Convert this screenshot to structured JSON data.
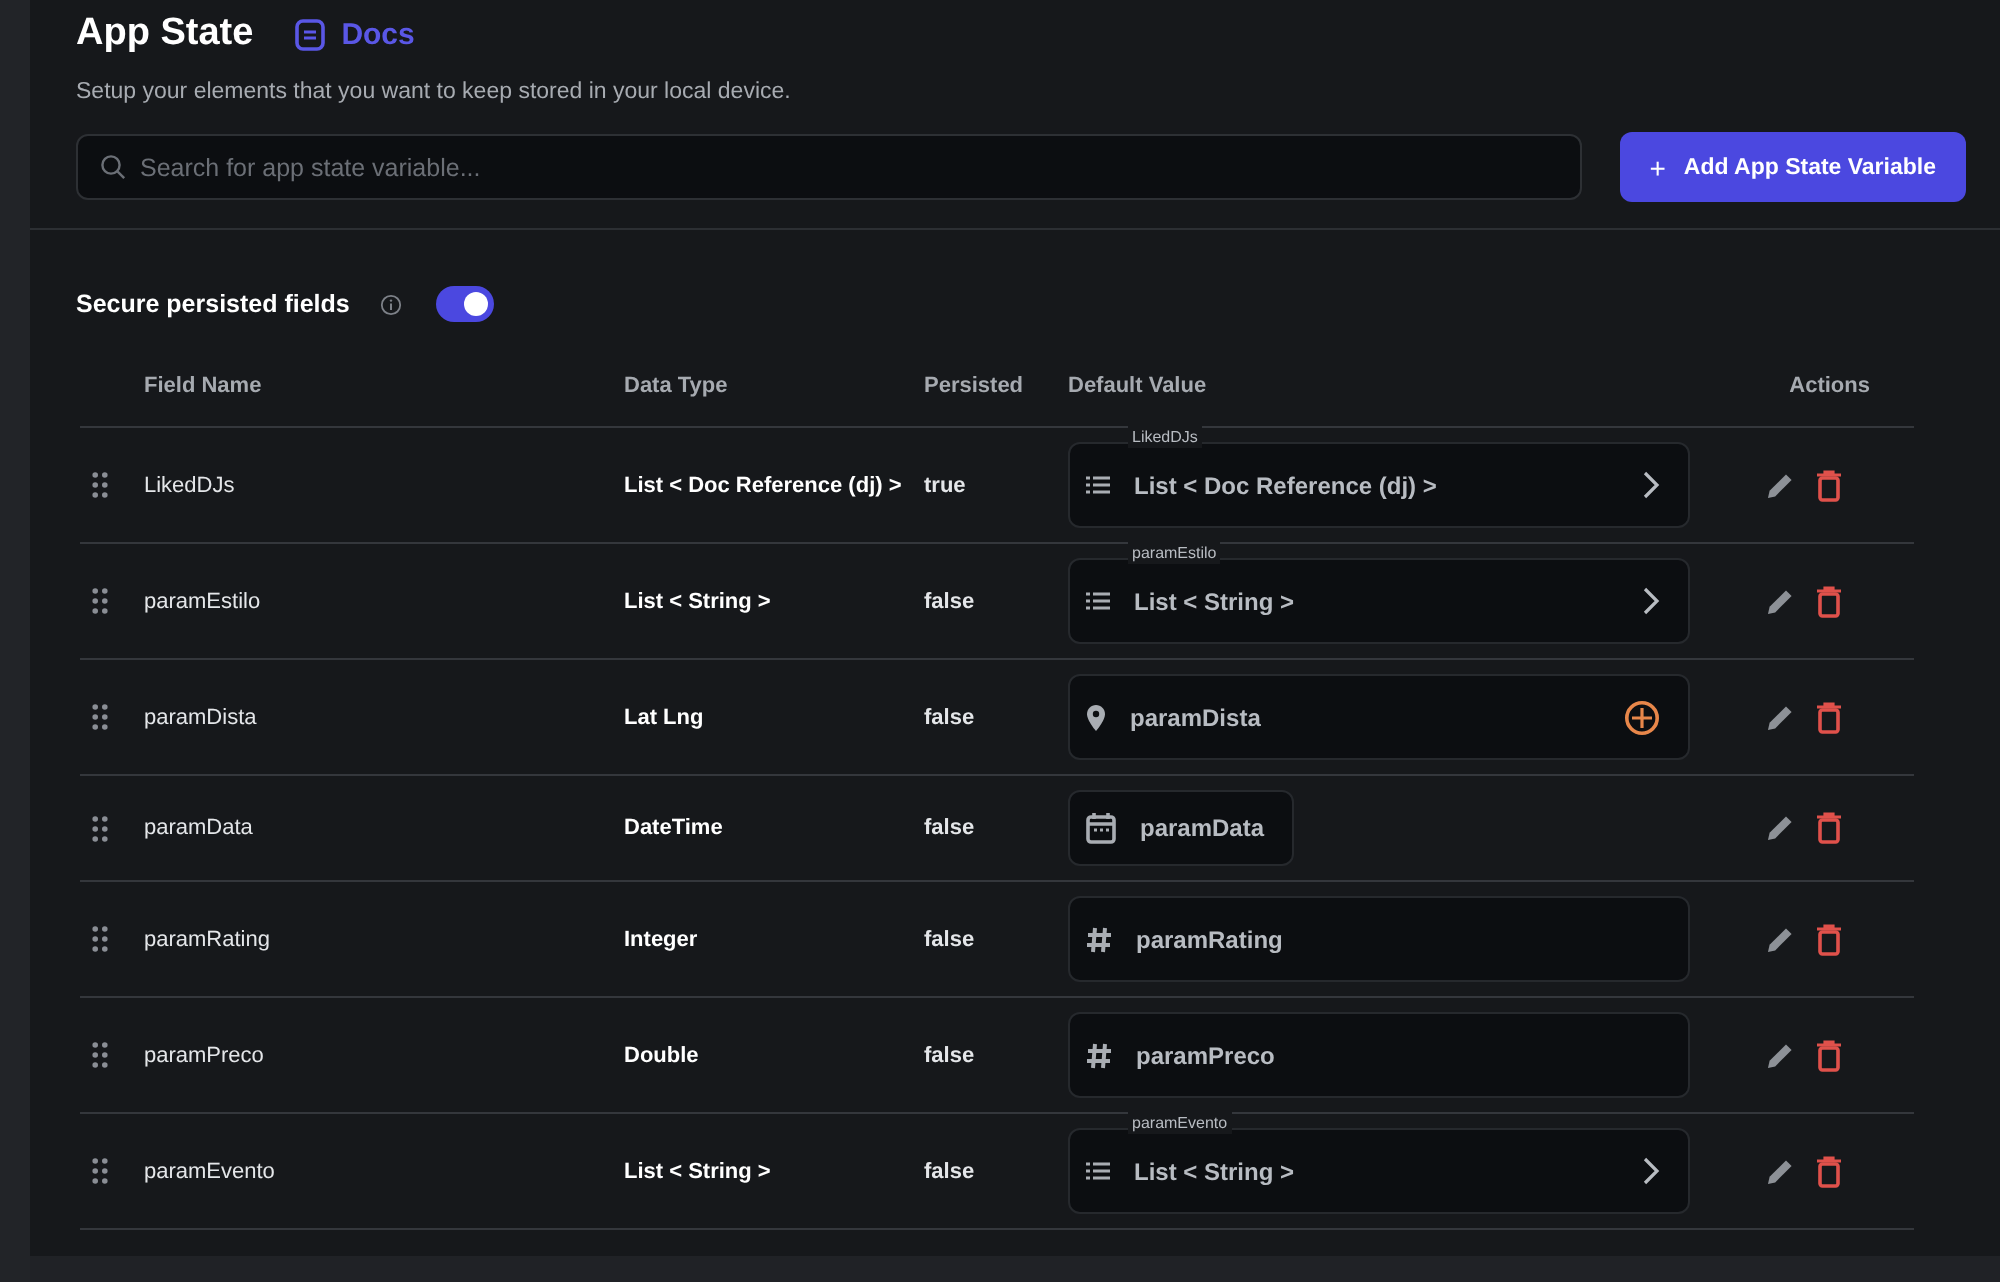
{
  "header": {
    "title": "App State",
    "docs_link": "Docs",
    "subtitle": "Setup your elements that you want to keep stored in your local device."
  },
  "search": {
    "placeholder": "Search for app state variable..."
  },
  "add_button": {
    "icon": "+",
    "label": "Add App State Variable"
  },
  "secure_toggle": {
    "label": "Secure persisted fields",
    "on": true
  },
  "table": {
    "columns": [
      "Field Name",
      "Data Type",
      "Persisted",
      "Default Value",
      "Actions"
    ],
    "rows": [
      {
        "field_name": "LikedDJs",
        "data_type": "List < Doc Reference (dj) >",
        "persisted": "true",
        "default": {
          "kind": "list",
          "label": "LikedDJs",
          "value": "List < Doc Reference (dj) >"
        }
      },
      {
        "field_name": "paramEstilo",
        "data_type": "List < String >",
        "persisted": "false",
        "default": {
          "kind": "list",
          "label": "paramEstilo",
          "value": "List < String >"
        }
      },
      {
        "field_name": "paramDista",
        "data_type": "Lat Lng",
        "persisted": "false",
        "default": {
          "kind": "latlng",
          "value": "paramDista"
        }
      },
      {
        "field_name": "paramData",
        "data_type": "DateTime",
        "persisted": "false",
        "default": {
          "kind": "datetime",
          "value": "paramData"
        }
      },
      {
        "field_name": "paramRating",
        "data_type": "Integer",
        "persisted": "false",
        "default": {
          "kind": "number",
          "value": "paramRating"
        }
      },
      {
        "field_name": "paramPreco",
        "data_type": "Double",
        "persisted": "false",
        "default": {
          "kind": "number",
          "value": "paramPreco"
        }
      },
      {
        "field_name": "paramEvento",
        "data_type": "List < String >",
        "persisted": "false",
        "default": {
          "kind": "list",
          "label": "paramEvento",
          "value": "List < String >"
        }
      }
    ]
  }
}
